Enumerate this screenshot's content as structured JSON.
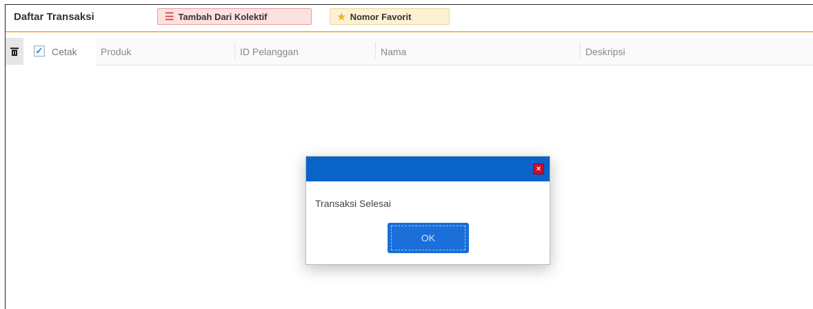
{
  "header": {
    "title": "Daftar Transaksi",
    "kolektif_label": "Tambah Dari Kolektif",
    "favorit_label": "Nomor Favorit"
  },
  "table": {
    "checkbox_checked": true,
    "cetak_label": "Cetak",
    "columns": [
      "Produk",
      "ID Pelanggan",
      "Nama",
      "Deskripsi"
    ]
  },
  "dialog": {
    "message": "Transaksi Selesai",
    "ok_label": "OK"
  },
  "colors": {
    "dialog_titlebar": "#0a63c9",
    "ok_button": "#1a6fd8",
    "close_button": "#c8102e",
    "header_underline": "#f0b860"
  },
  "icons": [
    "list-icon",
    "star-icon",
    "trash-icon",
    "check-icon",
    "close-icon"
  ]
}
